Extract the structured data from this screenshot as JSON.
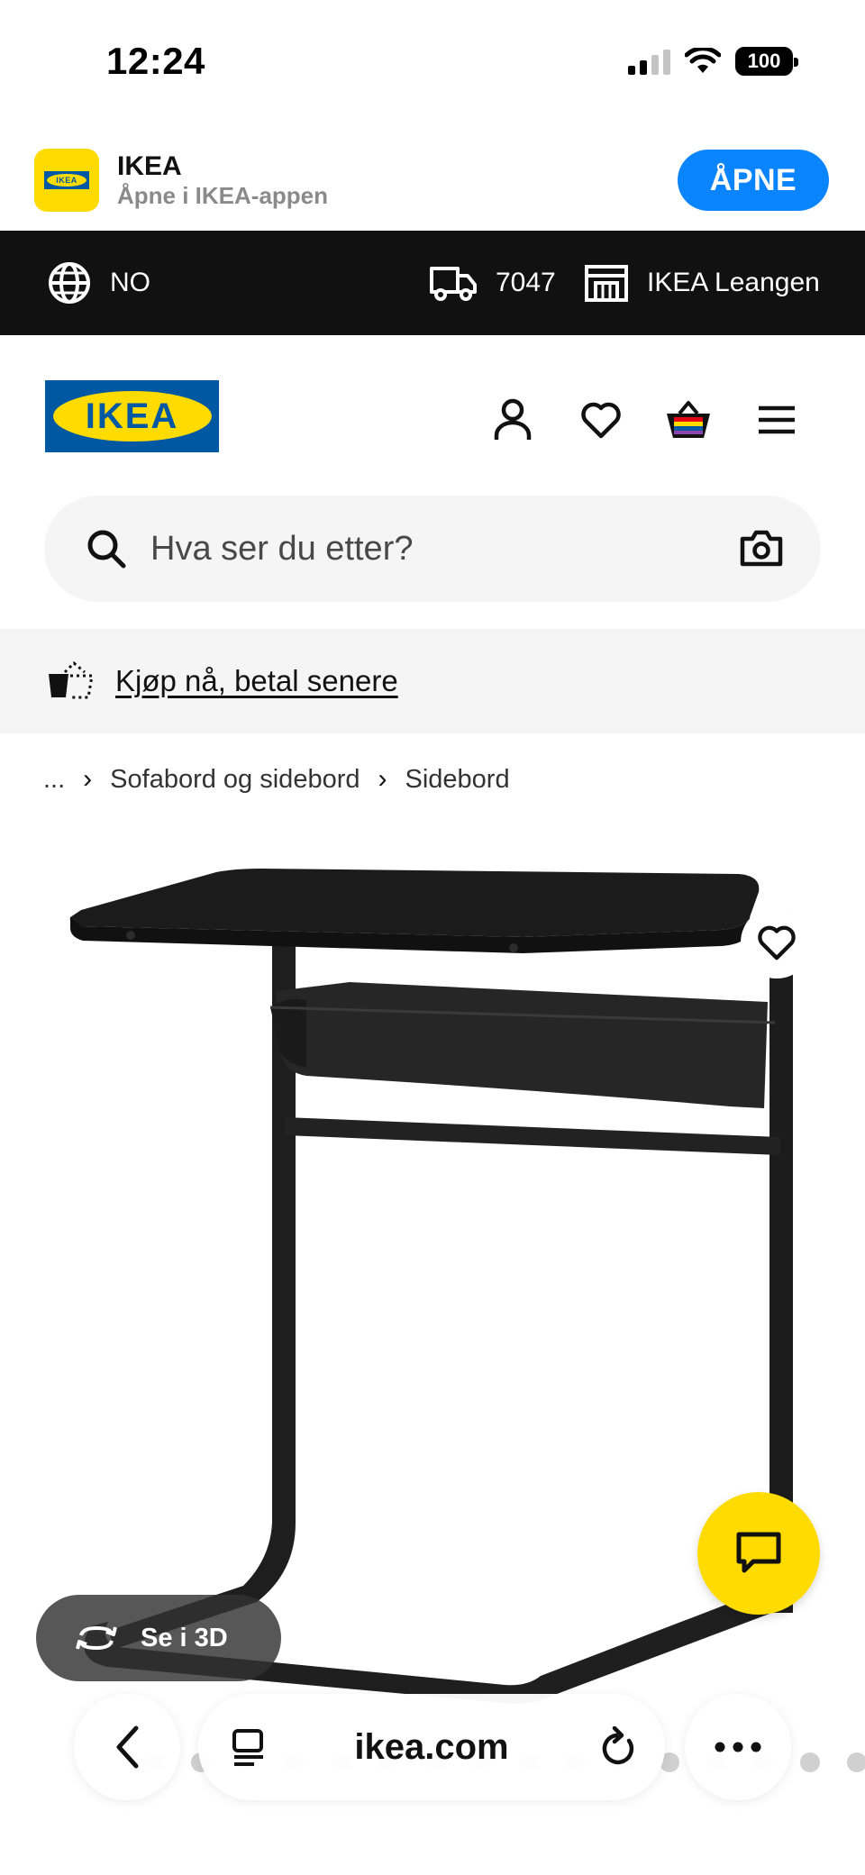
{
  "status_bar": {
    "time": "12:24",
    "battery": "100"
  },
  "app_banner": {
    "name": "IKEA",
    "subtitle": "Åpne i IKEA-appen",
    "open_label": "ÅPNE",
    "icon_logo_text": "IKEA"
  },
  "info_bar": {
    "country": "NO",
    "postcode": "7047",
    "store": "IKEA Leangen"
  },
  "header": {
    "logo_text": "IKEA"
  },
  "search": {
    "placeholder": "Hva ser du etter?"
  },
  "promo": {
    "paylater_label": "Kjøp nå, betal senere"
  },
  "breadcrumb": {
    "ellipsis": "...",
    "items": [
      "Sofabord og sidebord",
      "Sidebord"
    ]
  },
  "product": {
    "view_3d_label": "Se i 3D"
  },
  "browser": {
    "url": "ikea.com"
  },
  "colors": {
    "ikea_blue": "#0058a3",
    "ikea_yellow": "#ffdb00",
    "open_button": "#0a84ff",
    "info_bar": "#111111"
  },
  "icons": [
    "signal-icon",
    "wifi-icon",
    "battery-icon",
    "globe-icon",
    "truck-icon",
    "store-icon",
    "user-icon",
    "heart-icon",
    "basket-icon",
    "menu-icon",
    "search-icon",
    "camera-icon",
    "pay-later-icon",
    "chevron-right-icon",
    "chat-icon",
    "rotate-3d-icon",
    "back-chevron-icon",
    "reader-icon",
    "reload-icon",
    "more-icon"
  ]
}
